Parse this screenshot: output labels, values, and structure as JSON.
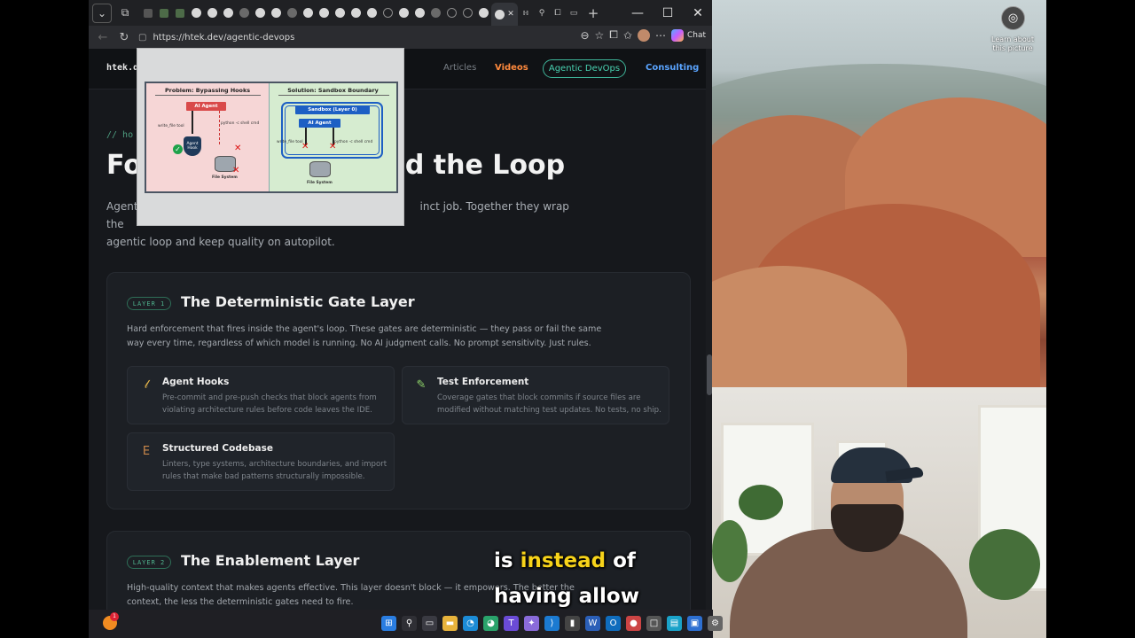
{
  "browser": {
    "url": "https://htek.dev/agentic-devops",
    "tab_icons": [
      "ghost-tab",
      "sq",
      "sq",
      "gh",
      "gh",
      "gh",
      "gh-dim",
      "gh",
      "gh",
      "gh-dim",
      "gh",
      "gh",
      "gh",
      "gh",
      "gh",
      "glob",
      "gh",
      "gh",
      "gh-dim",
      "glob",
      "glob",
      "gh"
    ],
    "chat_label": "Chat",
    "win_min": "—",
    "win_max": "☐",
    "win_close": "✕",
    "new_tab": "+",
    "close_tab": "✕"
  },
  "site": {
    "logo": "htek.d",
    "nav": {
      "connect": "nect",
      "articles": "Articles",
      "videos": "Videos",
      "agentic": "Agentic DevOps",
      "consulting": "Consulting"
    },
    "hero": {
      "tag": "// ho",
      "title_left": "Fo",
      "title_right": "d the Loop",
      "sub_line1_left": "Agent",
      "sub_line1_right": "inct job. Together they wrap the",
      "sub_line2": "agentic loop and keep quality on autopilot."
    },
    "layer1": {
      "badge": "LAYER 1",
      "title": "The Deterministic Gate Layer",
      "desc": "Hard enforcement that fires inside the agent's loop. These gates are deterministic — they pass or fail the same way every time, regardless of which model is running. No AI judgment calls. No prompt sensitivity. Just rules.",
      "features": [
        {
          "title": "Agent Hooks",
          "desc": "Pre-commit and pre-push checks that block agents from violating architecture rules before code leaves the IDE.",
          "icon": "hook-icon",
          "glyph": "𝓁",
          "color": "#e0b24a"
        },
        {
          "title": "Test Enforcement",
          "desc": "Coverage gates that block commits if source files are modified without matching test updates. No tests, no ship.",
          "icon": "test-tube-icon",
          "glyph": "✎",
          "color": "#8fd46a"
        },
        {
          "title": "Structured Codebase",
          "desc": "Linters, type systems, architecture boundaries, and import rules that make bad patterns structurally impossible.",
          "icon": "structure-icon",
          "glyph": "E",
          "color": "#c9874a"
        }
      ]
    },
    "layer2": {
      "badge": "LAYER 2",
      "title": "The Enablement Layer",
      "desc": "High-quality context that makes agents effective. This layer doesn't block — it empowers. The better the context, the less the deterministic gates need to fire."
    }
  },
  "diagram": {
    "left_title": "Problem: Bypassing Hooks",
    "right_title": "Solution: Sandbox Boundary",
    "ai_agent": "AI Agent",
    "write_file_tool": "write_file tool",
    "python_cmd": "python -c shell cmd",
    "agent_hook": "Agent Hook",
    "file_system": "File System",
    "sandbox": "Sandbox (Layer 0)"
  },
  "captions": {
    "line1_pre": "is ",
    "line1_hl": "instead",
    "line1_post": " of",
    "line2": "having allow"
  },
  "lens": {
    "label": "Learn about this picture"
  },
  "taskbar": {
    "badge": "1"
  }
}
